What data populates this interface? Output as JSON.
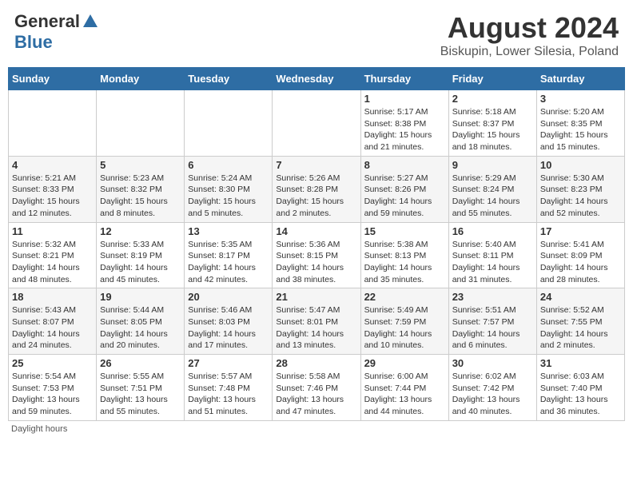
{
  "header": {
    "logo_general": "General",
    "logo_blue": "Blue",
    "month_title": "August 2024",
    "location": "Biskupin, Lower Silesia, Poland"
  },
  "days_of_week": [
    "Sunday",
    "Monday",
    "Tuesday",
    "Wednesday",
    "Thursday",
    "Friday",
    "Saturday"
  ],
  "weeks": [
    [
      {
        "day": "",
        "info": ""
      },
      {
        "day": "",
        "info": ""
      },
      {
        "day": "",
        "info": ""
      },
      {
        "day": "",
        "info": ""
      },
      {
        "day": "1",
        "info": "Sunrise: 5:17 AM\nSunset: 8:38 PM\nDaylight: 15 hours and 21 minutes."
      },
      {
        "day": "2",
        "info": "Sunrise: 5:18 AM\nSunset: 8:37 PM\nDaylight: 15 hours and 18 minutes."
      },
      {
        "day": "3",
        "info": "Sunrise: 5:20 AM\nSunset: 8:35 PM\nDaylight: 15 hours and 15 minutes."
      }
    ],
    [
      {
        "day": "4",
        "info": "Sunrise: 5:21 AM\nSunset: 8:33 PM\nDaylight: 15 hours and 12 minutes."
      },
      {
        "day": "5",
        "info": "Sunrise: 5:23 AM\nSunset: 8:32 PM\nDaylight: 15 hours and 8 minutes."
      },
      {
        "day": "6",
        "info": "Sunrise: 5:24 AM\nSunset: 8:30 PM\nDaylight: 15 hours and 5 minutes."
      },
      {
        "day": "7",
        "info": "Sunrise: 5:26 AM\nSunset: 8:28 PM\nDaylight: 15 hours and 2 minutes."
      },
      {
        "day": "8",
        "info": "Sunrise: 5:27 AM\nSunset: 8:26 PM\nDaylight: 14 hours and 59 minutes."
      },
      {
        "day": "9",
        "info": "Sunrise: 5:29 AM\nSunset: 8:24 PM\nDaylight: 14 hours and 55 minutes."
      },
      {
        "day": "10",
        "info": "Sunrise: 5:30 AM\nSunset: 8:23 PM\nDaylight: 14 hours and 52 minutes."
      }
    ],
    [
      {
        "day": "11",
        "info": "Sunrise: 5:32 AM\nSunset: 8:21 PM\nDaylight: 14 hours and 48 minutes."
      },
      {
        "day": "12",
        "info": "Sunrise: 5:33 AM\nSunset: 8:19 PM\nDaylight: 14 hours and 45 minutes."
      },
      {
        "day": "13",
        "info": "Sunrise: 5:35 AM\nSunset: 8:17 PM\nDaylight: 14 hours and 42 minutes."
      },
      {
        "day": "14",
        "info": "Sunrise: 5:36 AM\nSunset: 8:15 PM\nDaylight: 14 hours and 38 minutes."
      },
      {
        "day": "15",
        "info": "Sunrise: 5:38 AM\nSunset: 8:13 PM\nDaylight: 14 hours and 35 minutes."
      },
      {
        "day": "16",
        "info": "Sunrise: 5:40 AM\nSunset: 8:11 PM\nDaylight: 14 hours and 31 minutes."
      },
      {
        "day": "17",
        "info": "Sunrise: 5:41 AM\nSunset: 8:09 PM\nDaylight: 14 hours and 28 minutes."
      }
    ],
    [
      {
        "day": "18",
        "info": "Sunrise: 5:43 AM\nSunset: 8:07 PM\nDaylight: 14 hours and 24 minutes."
      },
      {
        "day": "19",
        "info": "Sunrise: 5:44 AM\nSunset: 8:05 PM\nDaylight: 14 hours and 20 minutes."
      },
      {
        "day": "20",
        "info": "Sunrise: 5:46 AM\nSunset: 8:03 PM\nDaylight: 14 hours and 17 minutes."
      },
      {
        "day": "21",
        "info": "Sunrise: 5:47 AM\nSunset: 8:01 PM\nDaylight: 14 hours and 13 minutes."
      },
      {
        "day": "22",
        "info": "Sunrise: 5:49 AM\nSunset: 7:59 PM\nDaylight: 14 hours and 10 minutes."
      },
      {
        "day": "23",
        "info": "Sunrise: 5:51 AM\nSunset: 7:57 PM\nDaylight: 14 hours and 6 minutes."
      },
      {
        "day": "24",
        "info": "Sunrise: 5:52 AM\nSunset: 7:55 PM\nDaylight: 14 hours and 2 minutes."
      }
    ],
    [
      {
        "day": "25",
        "info": "Sunrise: 5:54 AM\nSunset: 7:53 PM\nDaylight: 13 hours and 59 minutes."
      },
      {
        "day": "26",
        "info": "Sunrise: 5:55 AM\nSunset: 7:51 PM\nDaylight: 13 hours and 55 minutes."
      },
      {
        "day": "27",
        "info": "Sunrise: 5:57 AM\nSunset: 7:48 PM\nDaylight: 13 hours and 51 minutes."
      },
      {
        "day": "28",
        "info": "Sunrise: 5:58 AM\nSunset: 7:46 PM\nDaylight: 13 hours and 47 minutes."
      },
      {
        "day": "29",
        "info": "Sunrise: 6:00 AM\nSunset: 7:44 PM\nDaylight: 13 hours and 44 minutes."
      },
      {
        "day": "30",
        "info": "Sunrise: 6:02 AM\nSunset: 7:42 PM\nDaylight: 13 hours and 40 minutes."
      },
      {
        "day": "31",
        "info": "Sunrise: 6:03 AM\nSunset: 7:40 PM\nDaylight: 13 hours and 36 minutes."
      }
    ]
  ],
  "footer": "Daylight hours"
}
